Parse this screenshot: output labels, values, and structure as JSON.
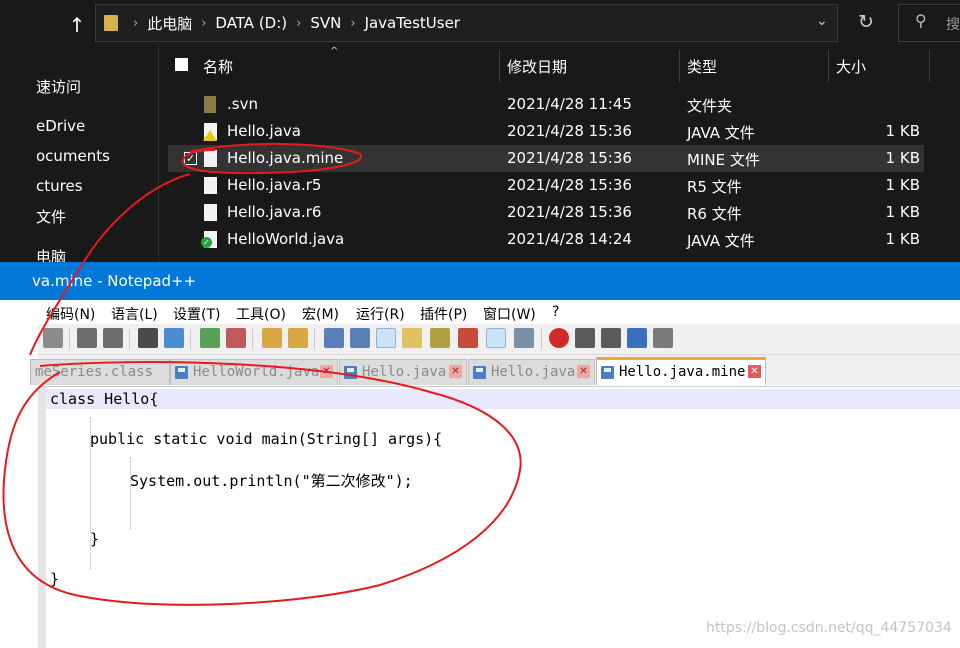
{
  "explorer": {
    "path": [
      "此电脑",
      "DATA (D:)",
      "SVN",
      "JavaTestUser"
    ],
    "search_placeholder": "搜",
    "sidebar": [
      "速访问",
      "eDrive",
      "ocuments",
      "ctures",
      "文件",
      "电脑"
    ],
    "columns": {
      "name": "名称",
      "date": "修改日期",
      "type": "类型",
      "size": "大小"
    },
    "files": [
      {
        "name": ".svn",
        "date": "2021/4/28 11:45",
        "type": "文件夹",
        "size": "",
        "icon": "svn-folder-icon"
      },
      {
        "name": "Hello.java",
        "date": "2021/4/28 15:36",
        "type": "JAVA 文件",
        "size": "1 KB",
        "icon": "conflict-file-icon"
      },
      {
        "name": "Hello.java.mine",
        "date": "2021/4/28 15:36",
        "type": "MINE 文件",
        "size": "1 KB",
        "icon": "file-icon",
        "selected": true
      },
      {
        "name": "Hello.java.r5",
        "date": "2021/4/28 15:36",
        "type": "R5 文件",
        "size": "1 KB",
        "icon": "file-icon"
      },
      {
        "name": "Hello.java.r6",
        "date": "2021/4/28 15:36",
        "type": "R6 文件",
        "size": "1 KB",
        "icon": "file-icon"
      },
      {
        "name": "HelloWorld.java",
        "date": "2021/4/28 14:24",
        "type": "JAVA 文件",
        "size": "1 KB",
        "icon": "normal-file-icon"
      }
    ]
  },
  "notepad": {
    "title": "va.mine - Notepad++",
    "menu": [
      "编码(N)",
      "语言(L)",
      "设置(T)",
      "工具(O)",
      "宏(M)",
      "运行(R)",
      "插件(P)",
      "窗口(W)",
      "?"
    ],
    "tabs": [
      {
        "label": "meSeries.class",
        "active": false
      },
      {
        "label": "HelloWorld.java",
        "active": false
      },
      {
        "label": "Hello.java",
        "active": false
      },
      {
        "label": "Hello.java",
        "active": false
      },
      {
        "label": "Hello.java.mine",
        "active": true
      }
    ],
    "code": [
      "class Hello{",
      "public static void main(String[] args){",
      "System.out.println(\"第二次修改\");",
      "}",
      "}"
    ]
  },
  "watermark": "https://blog.csdn.net/qq_44757034",
  "colors": {
    "explorer_bg": "#191919",
    "title_bar": "#0078d7",
    "annotation": "#e8191e",
    "active_tab_accent": "#f8a13e"
  }
}
